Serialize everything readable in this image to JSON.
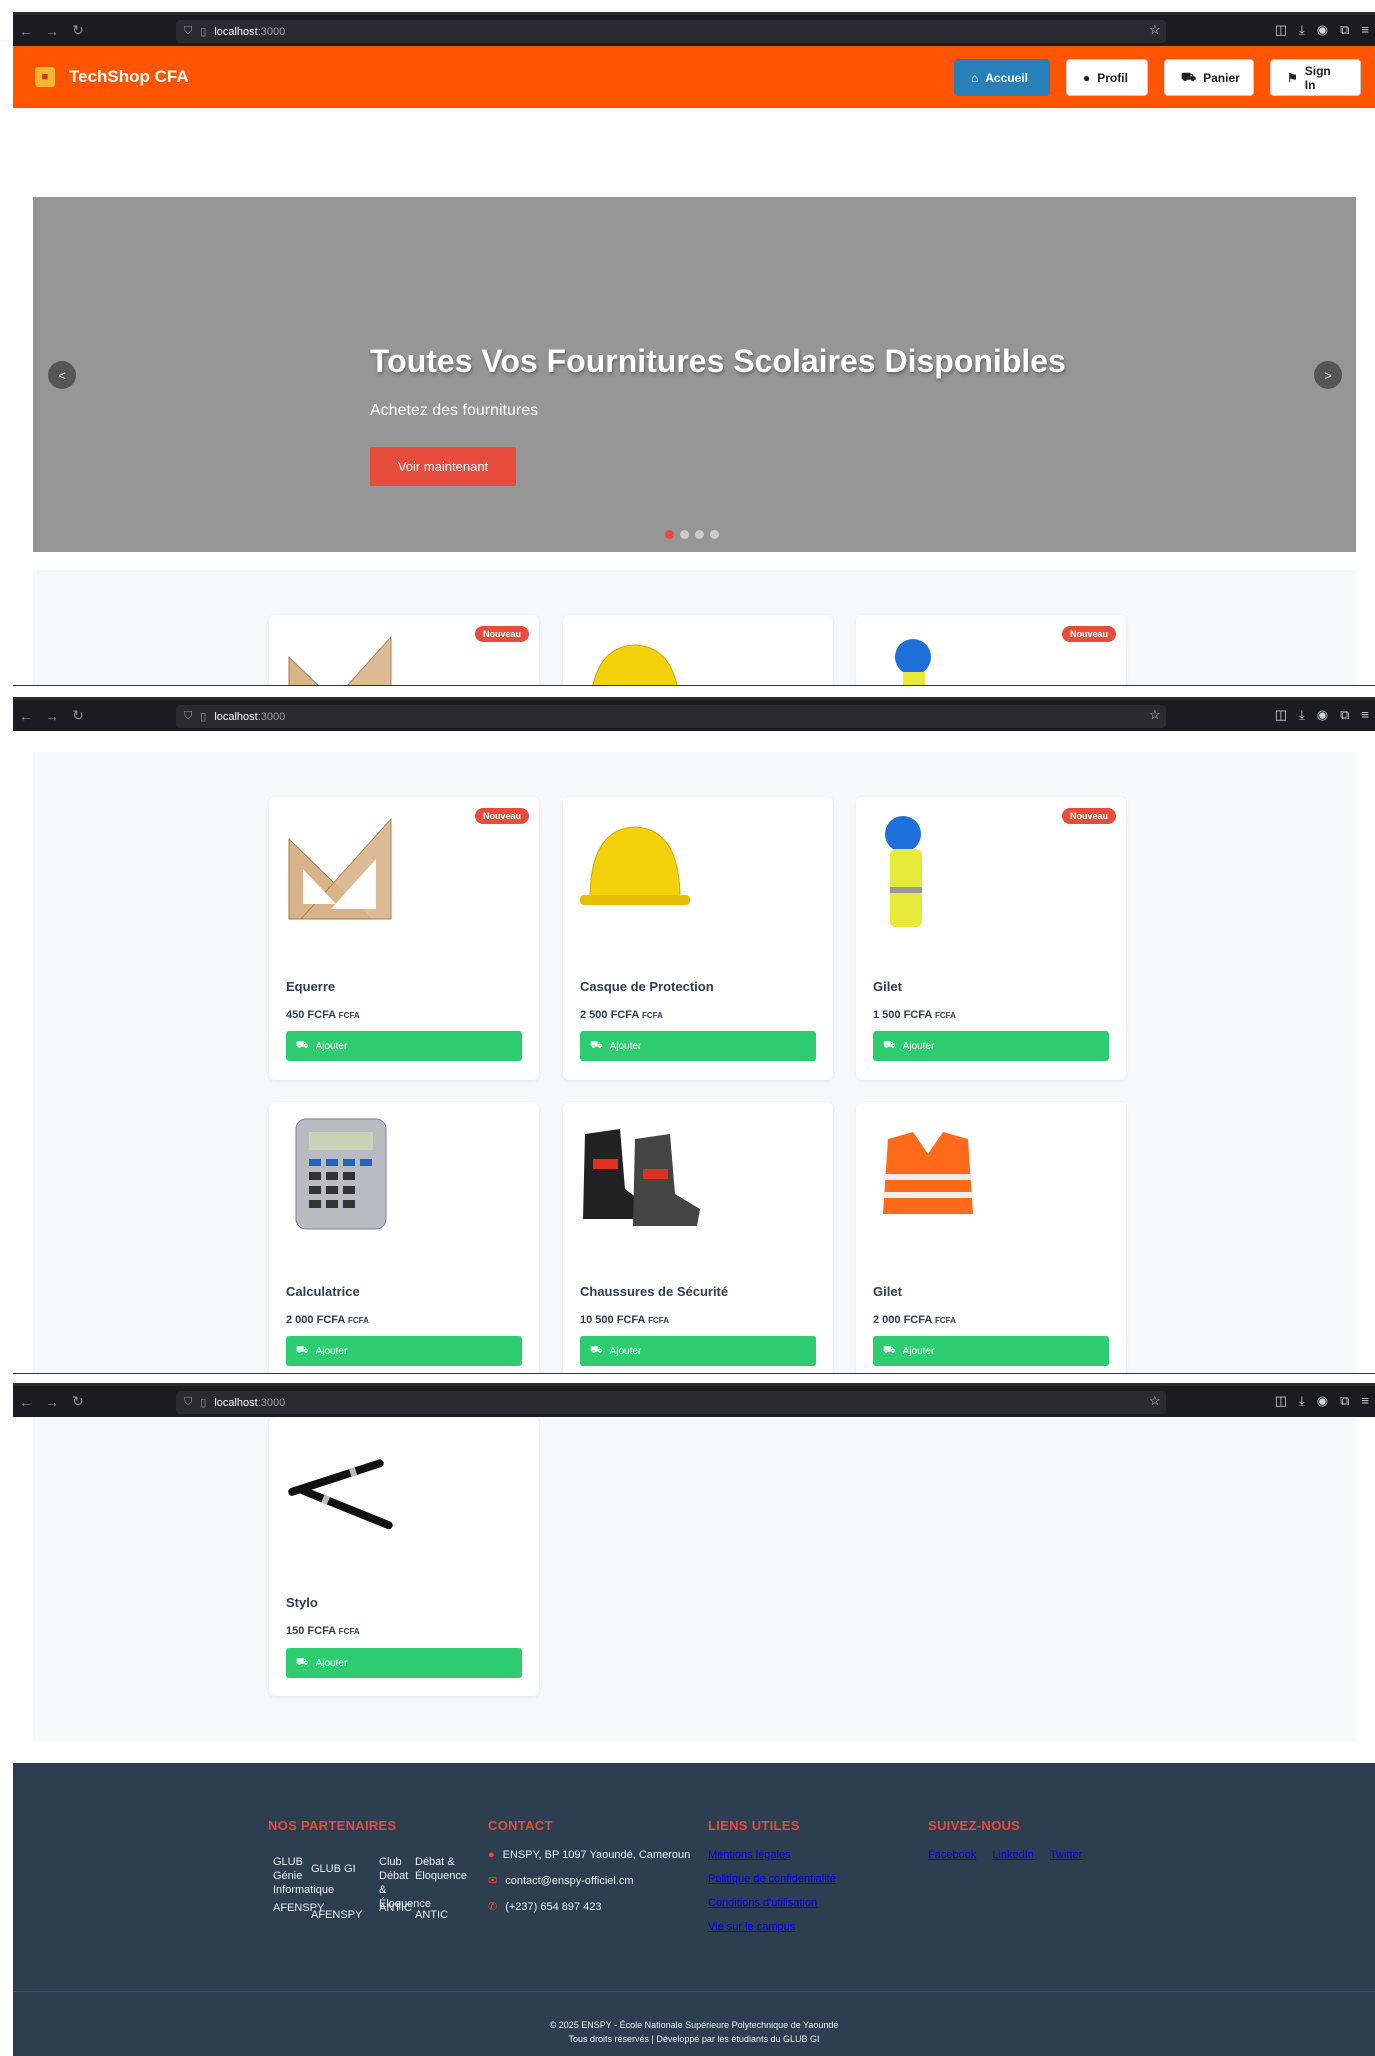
{
  "browser": {
    "url_host": "localhost",
    "url_port": ":3000"
  },
  "header": {
    "brand": "TechShop CFA",
    "nav": [
      {
        "label": "Accueil",
        "icon": "home-icon",
        "active": true
      },
      {
        "label": "Profil",
        "icon": "user-icon",
        "active": false
      },
      {
        "label": "Panier",
        "icon": "cart-icon",
        "active": false
      },
      {
        "label": "Sign In",
        "icon": "flag-icon",
        "active": false
      }
    ]
  },
  "hero": {
    "title": "Toutes Vos Fournitures Scolaires Disponibles",
    "subtitle": "Achetez des fournitures",
    "cta": "Voir maintenant",
    "prev": "<",
    "next": ">",
    "slides": 4,
    "active_slide": 1
  },
  "products": {
    "add_label": "Ajouter",
    "currency": "FCFA",
    "badge_label": "Nouveau",
    "items": [
      {
        "name": "Equerre",
        "price": "450 FCFA",
        "badge": true,
        "image": "set-square"
      },
      {
        "name": "Casque de Protection",
        "price": "2 500 FCFA",
        "badge": false,
        "image": "helmet"
      },
      {
        "name": "Gilet",
        "price": "1 500 FCFA",
        "badge": true,
        "image": "jacket"
      },
      {
        "name": "Calculatrice",
        "price": "2 000 FCFA",
        "badge": false,
        "image": "calculator"
      },
      {
        "name": "Chaussures de Sécurité",
        "price": "10 500 FCFA",
        "badge": false,
        "image": "boots"
      },
      {
        "name": "Gilet",
        "price": "2 000 FCFA",
        "badge": false,
        "image": "vest"
      },
      {
        "name": "Stylo",
        "price": "150 FCFA",
        "badge": false,
        "image": "pens"
      }
    ]
  },
  "footer": {
    "partners_title": "NOS PARTENAIRES",
    "partners": {
      "glub_alt": "GLUB Génie Informatique",
      "glub": "GLUB GI",
      "club_alt": "Club Débat & Éloquence",
      "club": "Débat & Éloquence",
      "afenspy_alt": "AFENSPY",
      "afenspy": "AFENSPY",
      "antic_alt": "ANTIC",
      "antic": "ANTIC"
    },
    "contact_title": "CONTACT",
    "contact": {
      "address": "ENSPY, BP 1097 Yaoundé, Cameroun",
      "email": "contact@enspy-officiel.cm",
      "phone": "(+237) 654 897 423"
    },
    "links_title": "LIENS UTILES",
    "links": [
      "Mentions légales",
      "Politique de confidentialité",
      "Conditions d'utilisation",
      "Vie sur le campus"
    ],
    "social_title": "SUIVEZ-NOUS",
    "social": [
      "Facebook",
      "LinkedIn",
      "Twitter"
    ],
    "copyright": "© 2025 ENSPY - École Nationale Supérieure Polytechnique de Yaoundé",
    "rights": "Tous droits réservés | Développé par les étudiants du GLUB GI"
  },
  "colors": {
    "header": "#ff5500",
    "accent_red": "#e74c3c",
    "add_green": "#2ecc71",
    "active_blue": "#2980b9",
    "footer_bg": "#2c3e50"
  }
}
